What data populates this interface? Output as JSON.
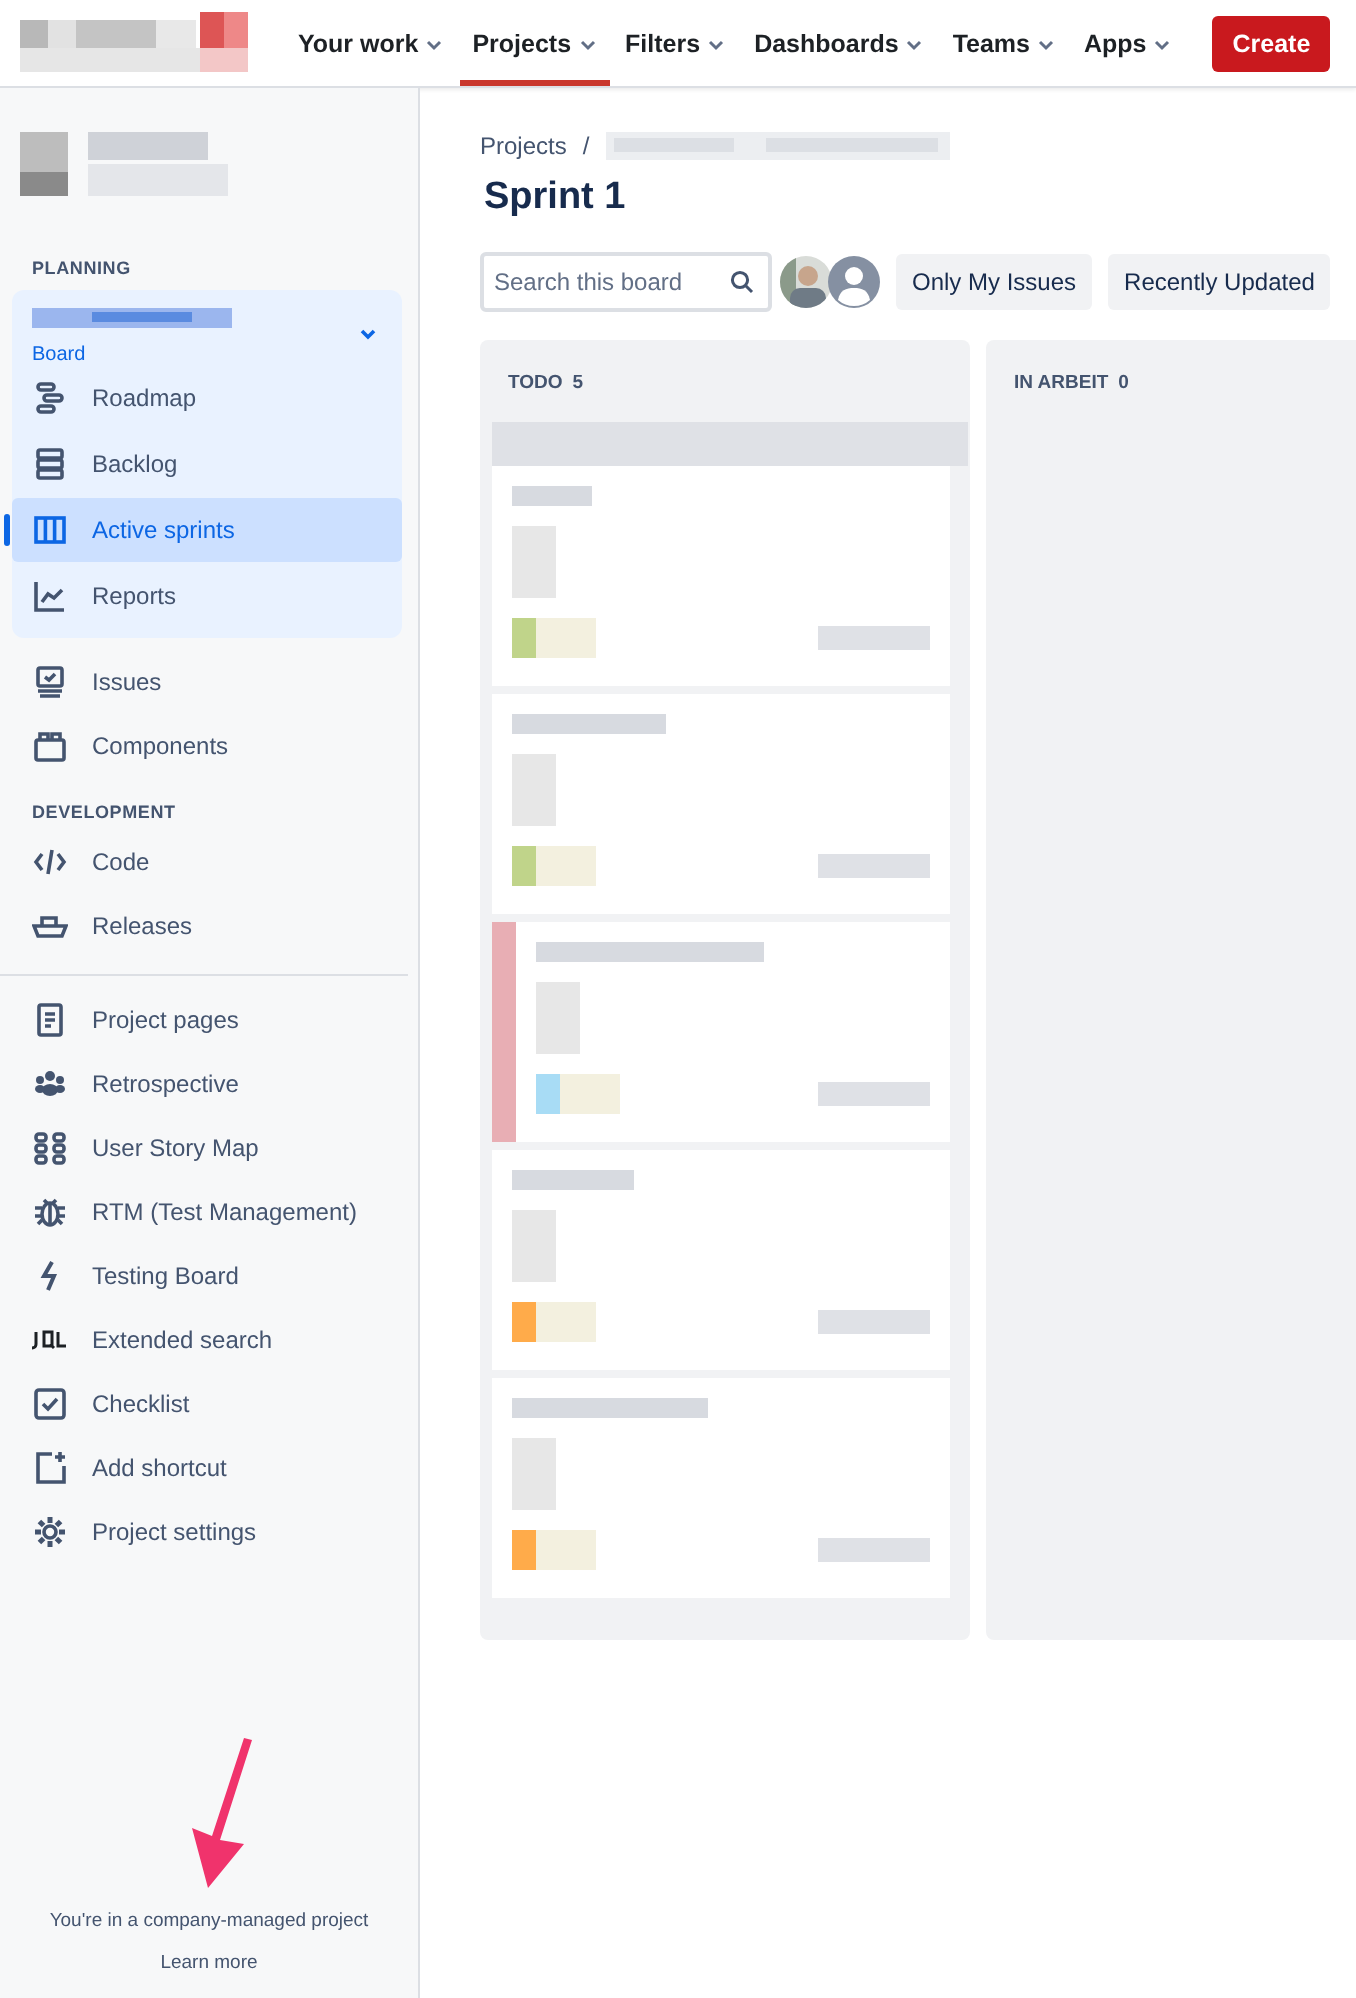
{
  "nav": {
    "items": [
      {
        "label": "Your work",
        "selected": false
      },
      {
        "label": "Projects",
        "selected": true
      },
      {
        "label": "Filters",
        "selected": false
      },
      {
        "label": "Dashboards",
        "selected": false
      },
      {
        "label": "Teams",
        "selected": false
      },
      {
        "label": "Apps",
        "selected": false
      }
    ],
    "create": "Create"
  },
  "sidebar": {
    "planning_heading": "PLANNING",
    "board_group": {
      "label": "Board",
      "expanded": true,
      "items": [
        {
          "label": "Roadmap",
          "selected": false
        },
        {
          "label": "Backlog",
          "selected": false
        },
        {
          "label": "Active sprints",
          "selected": true
        },
        {
          "label": "Reports",
          "selected": false
        }
      ]
    },
    "items": [
      {
        "label": "Issues",
        "selected": false
      },
      {
        "label": "Components",
        "selected": false
      }
    ],
    "development_heading": "DEVELOPMENT",
    "development_items": [
      {
        "label": "Code",
        "selected": false
      },
      {
        "label": "Releases",
        "selected": false
      }
    ],
    "shortcuts": [
      {
        "label": "Project pages",
        "selected": false
      },
      {
        "label": "Retrospective",
        "selected": false
      },
      {
        "label": "User Story Map",
        "selected": false
      },
      {
        "label": "RTM (Test Management)",
        "selected": false
      },
      {
        "label": "Testing Board",
        "selected": false
      },
      {
        "label": "Extended search",
        "selected": false
      },
      {
        "label": "Checklist",
        "selected": false
      },
      {
        "label": "Add shortcut",
        "selected": false
      },
      {
        "label": "Project settings",
        "selected": false
      }
    ],
    "footer": {
      "text": "You're in a company-managed project",
      "link": "Learn more"
    }
  },
  "board": {
    "breadcrumb": "Projects",
    "separator": "/",
    "title": "Sprint 1",
    "search": {
      "placeholder": "Search this board"
    },
    "filters": [
      "Only My Issues",
      "Recently Updated"
    ],
    "columns": [
      {
        "title": "TODO",
        "count": "5",
        "cards": [
          {
            "color": "#c0d48a",
            "flagged": false
          },
          {
            "color": "#c0d48a",
            "flagged": false
          },
          {
            "color": "#a8dcf5",
            "flagged": true
          },
          {
            "color": "#ffab4a",
            "flagged": false
          },
          {
            "color": "#ffab4a",
            "flagged": false
          }
        ]
      },
      {
        "title": "IN ARBEIT",
        "count": "0"
      }
    ]
  }
}
